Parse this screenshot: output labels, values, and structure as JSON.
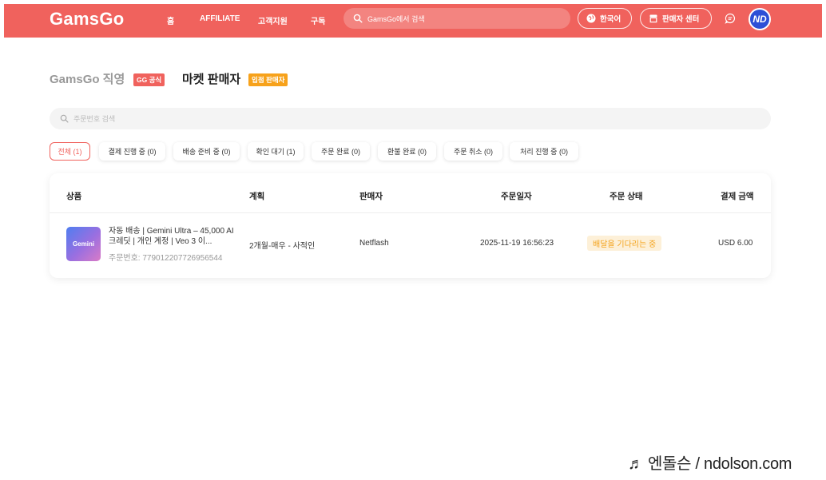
{
  "header": {
    "logo": "GamsGo",
    "nav": [
      "홈",
      "AFFILIATE",
      "고객지원",
      "구독"
    ],
    "search_placeholder": "GamsGo에서 검색",
    "language": "한국어",
    "seller_center": "판매자 센터",
    "avatar_initials": "ND",
    "brand_color": "#f0625d"
  },
  "seller_tabs": {
    "direct": "GamsGo 직영",
    "direct_badge": "GG 공식",
    "market": "마켓 판매자",
    "market_badge": "입점 판매자"
  },
  "order_search_placeholder": "주문번호 검색",
  "filters": [
    {
      "label": "전체 (1)",
      "active": true
    },
    {
      "label": "결제 진행 중 (0)",
      "active": false
    },
    {
      "label": "배송 준비 중 (0)",
      "active": false
    },
    {
      "label": "확인 대기 (1)",
      "active": false
    },
    {
      "label": "주문 완료 (0)",
      "active": false
    },
    {
      "label": "환불 완료 (0)",
      "active": false
    },
    {
      "label": "주문 취소 (0)",
      "active": false
    },
    {
      "label": "처리 진행 중 (0)",
      "active": false
    }
  ],
  "table": {
    "columns": [
      "상품",
      "계획",
      "판매자",
      "주문일자",
      "주문 상태",
      "결제 금액"
    ],
    "rows": [
      {
        "thumb_label": "Gemini",
        "title": "자동 배송 | Gemini Ultra – 45,000 AI 크레딧 | 개인 계정 | Veo 3 이...",
        "order_no": "주문번호: 779012207726956544",
        "plan": "2개월-매우 - 사적인",
        "seller": "Netflash",
        "date": "2025-11-19 16:56:23",
        "status": "배달을 기다리는 중",
        "amount": "USD 6.00"
      }
    ]
  },
  "watermark": "♬ 엔돌슨 / ndolson.com"
}
